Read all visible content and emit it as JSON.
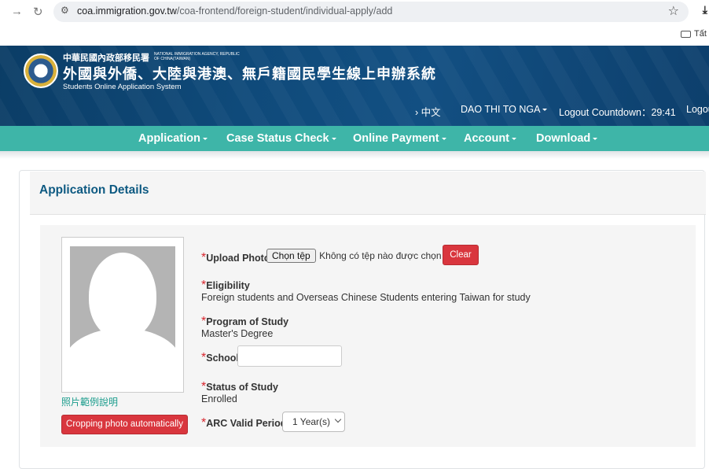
{
  "browser": {
    "url_domain": "coa.immigration.gov.tw",
    "url_path": "/coa-frontend/foreign-student/individual-apply/add",
    "bookmark_folder": "Tất"
  },
  "header": {
    "agency_zh": "中華民國內政部移民署",
    "agency_en": "NATIONAL IMMIGRATION AGENCY, REPUBLIC OF CHINA(TAIWAN)",
    "system_title": "外國與外僑、大陸與港澳、無戶籍國民學生線上申辦系統",
    "system_title_en": "Students Online Application System",
    "language": "中文",
    "user": "DAO THI TO NGA",
    "logout_countdown_label": "Logout Countdown：",
    "logout_countdown": "29:41",
    "logout": "Logout"
  },
  "nav": [
    "Application",
    "Case Status Check",
    "Online Payment",
    "Account",
    "Download"
  ],
  "panel": {
    "title": "Application Details",
    "photo_example_link": "照片範例說明",
    "crop_button": "Cropping photo automatically",
    "upload_photo_label": "Upload Photo",
    "choose_file_button": "Chọn tệp",
    "no_file_text": "Không có tệp nào được chọn",
    "clear_button": "Clear",
    "eligibility_label": "Eligibility",
    "eligibility_value": "Foreign students and Overseas Chinese Students entering Taiwan for study",
    "program_label": "Program of Study",
    "program_value": "Master's Degree",
    "school_label": "School",
    "school_value": "",
    "status_label": "Status of Study",
    "status_value": "Enrolled",
    "arc_label": "ARC Valid Period",
    "arc_value": "1 Year(s)",
    "required_mark": "*"
  }
}
